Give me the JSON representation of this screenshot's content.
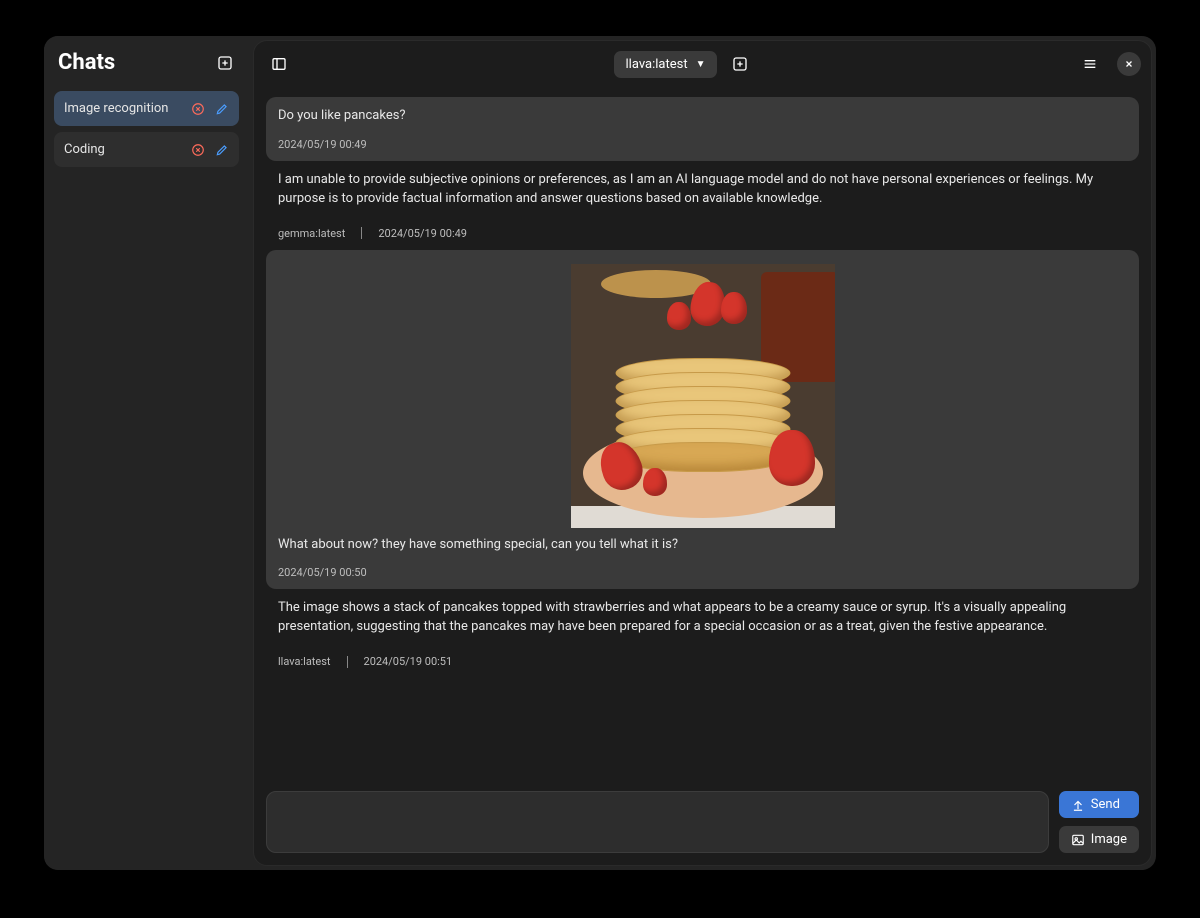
{
  "sidebar": {
    "title": "Chats",
    "items": [
      {
        "label": "Image recognition",
        "active": true
      },
      {
        "label": "Coding",
        "active": false
      }
    ]
  },
  "toolbar": {
    "model_label": "llava:latest"
  },
  "messages": {
    "m1": {
      "text": "Do you like pancakes?",
      "ts": "2024/05/19 00:49"
    },
    "a1": {
      "text": "I am unable to provide subjective opinions or preferences, as I am an AI language model and do not have personal experiences or feelings. My purpose is to provide factual information and answer questions based on available knowledge.",
      "model": "gemma:latest",
      "ts": "2024/05/19 00:49"
    },
    "m2": {
      "text": "What about now? they have something special, can you tell what it is?",
      "ts": "2024/05/19 00:50"
    },
    "a2": {
      "text": "The image shows a stack of pancakes topped with strawberries and what appears to be a creamy sauce or syrup. It's a visually appealing presentation, suggesting that the pancakes may have been prepared for a special occasion or as a treat, given the festive appearance.",
      "model": "llava:latest",
      "ts": "2024/05/19 00:51"
    }
  },
  "composer": {
    "placeholder": "",
    "send_label": "Send",
    "image_label": "Image"
  }
}
